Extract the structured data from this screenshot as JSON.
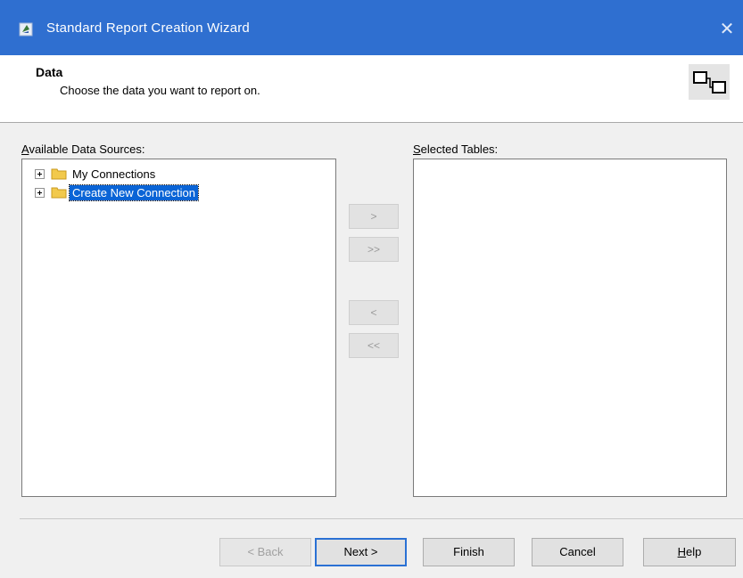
{
  "window": {
    "title": "Standard Report Creation Wizard",
    "close_glyph": "✕",
    "app_icon": "wizard-icon"
  },
  "header": {
    "title": "Data",
    "subtitle": "Choose the data you want to report on.",
    "icon": "table-link-icon"
  },
  "available": {
    "label_access": "A",
    "label_rest": "vailable Data Sources:",
    "items": [
      {
        "label": "My Connections",
        "selected": false
      },
      {
        "label": "Create New Connection",
        "selected": true
      }
    ]
  },
  "selected": {
    "label_access": "S",
    "label_rest": "elected Tables:"
  },
  "move_buttons": {
    "add": ">",
    "add_all": ">>",
    "remove": "<",
    "remove_all": "<<"
  },
  "footer": {
    "back": "< Back",
    "next": "Next >",
    "finish": "Finish",
    "cancel": "Cancel",
    "help_access": "H",
    "help_rest": "elp"
  },
  "colors": {
    "titlebar": "#2f6fd0",
    "selection": "#0a64d6",
    "default_button_border": "#2a71d4"
  }
}
